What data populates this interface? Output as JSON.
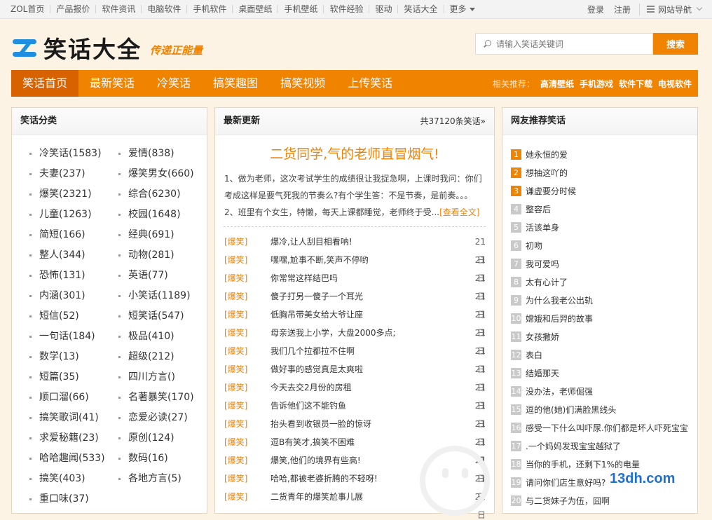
{
  "topbar": {
    "links": [
      "ZOL首页",
      "产品报价",
      "软件资讯",
      "电脑软件",
      "手机软件",
      "桌面壁纸",
      "手机壁纸",
      "软件经验",
      "驱动",
      "笑话大全"
    ],
    "more": "更多",
    "login": "登录",
    "register": "注册",
    "site_nav": "网站导航"
  },
  "header": {
    "logo_text": "笑话大全",
    "slogan": "传递正能量",
    "search_placeholder": "请输入笑话关键词",
    "search_button": "搜索"
  },
  "mainnav": {
    "tabs": [
      "笑话首页",
      "最新笑话",
      "冷笑话",
      "搞笑趣图",
      "搞笑视频",
      "上传笑话"
    ],
    "active_index": 0,
    "rec_label": "相关推荐：",
    "rec_links": [
      "高清壁纸",
      "手机游戏",
      "软件下载",
      "电视软件"
    ]
  },
  "left": {
    "title": "笑话分类",
    "categories": [
      "冷笑话(1583)",
      "爱情(838)",
      "夫妻(237)",
      "爆笑男女(660)",
      "爆笑(2321)",
      "综合(6230)",
      "儿童(1263)",
      "校园(1648)",
      "简短(166)",
      "经典(691)",
      "整人(344)",
      "动物(281)",
      "恐怖(131)",
      "英语(77)",
      "内涵(301)",
      "小笑话(1189)",
      "短信(52)",
      "短笑话(547)",
      "一句话(184)",
      "极品(410)",
      "数学(13)",
      "超级(212)",
      "短篇(35)",
      "四川方言()",
      "顺口溜(66)",
      "名著暴笑(170)",
      "搞笑歌词(41)",
      "恋爱必读(27)",
      "求爱秘籍(23)",
      "原创(124)",
      "哈哈趣闻(533)",
      "数码(16)",
      "搞笑(403)",
      "各地方言(5)",
      "重口味(37)"
    ]
  },
  "middle": {
    "title": "最新更新",
    "count": "共37120条笑话»",
    "headline": "二货同学,气的老师直冒烟气!",
    "summary": "1、做为老师，这次考试学生的成绩很让我捉急啊，上课时我问：你们考成这样是要气死我的节奏么?有个学生答：不是节奏，是前奏。。。2、班里有个女生，特懒，每天上课都睡觉，老师终于受...",
    "read_more": "[查看全文]",
    "news": [
      {
        "tag": "[爆笑]",
        "title": "爆冷,让人刮目相看呐!",
        "date": "21日"
      },
      {
        "tag": "[爆笑]",
        "title": "嘿嘿,尬事不断,笑声不停哟",
        "date": "21日"
      },
      {
        "tag": "[爆笑]",
        "title": "你常常这样结巴吗",
        "date": "21日"
      },
      {
        "tag": "[爆笑]",
        "title": "傻子打另一傻子一个耳光",
        "date": "21日"
      },
      {
        "tag": "[爆笑]",
        "title": "低胸吊带美女给大爷让座",
        "date": "21日"
      },
      {
        "tag": "[爆笑]",
        "title": "母亲送我上小学，大盘2000多点;",
        "date": "21日"
      },
      {
        "tag": "[爆笑]",
        "title": "我们几个拉都拉不住啊",
        "date": "21日"
      },
      {
        "tag": "[爆笑]",
        "title": "做好事的感觉真是太爽啦",
        "date": "21日"
      },
      {
        "tag": "[爆笑]",
        "title": "今天去交2月份的房租",
        "date": "21日"
      },
      {
        "tag": "[爆笑]",
        "title": "告诉他们这不能钓鱼",
        "date": "21日"
      },
      {
        "tag": "[爆笑]",
        "title": "抬头看到收银员一脸的惊讶",
        "date": "21日"
      },
      {
        "tag": "[爆笑]",
        "title": "逗B有笑才,搞笑不困难",
        "date": "21日"
      },
      {
        "tag": "[爆笑]",
        "title": "爆笑,他们的境界有些高!",
        "date": "21日"
      },
      {
        "tag": "[爆笑]",
        "title": "哈哈,都被老婆折腾的不轻呀!",
        "date": "21日"
      },
      {
        "tag": "[爆笑]",
        "title": "二货青年的爆笑尬事儿展",
        "date": "21日"
      }
    ]
  },
  "right": {
    "title": "网友推荐笑话",
    "items": [
      {
        "num": "1",
        "text": "她永恒的爱"
      },
      {
        "num": "2",
        "text": "想抽这吖的"
      },
      {
        "num": "3",
        "text": "谦虚要分时候"
      },
      {
        "num": "4",
        "text": "整容后"
      },
      {
        "num": "5",
        "text": "活该单身"
      },
      {
        "num": "6",
        "text": "初吻"
      },
      {
        "num": "7",
        "text": "我可爱吗"
      },
      {
        "num": "8",
        "text": "太有心计了"
      },
      {
        "num": "9",
        "text": "为什么我老公出轨"
      },
      {
        "num": "10",
        "text": "嫦娥和后羿的故事"
      },
      {
        "num": "11",
        "text": "女孩撒娇"
      },
      {
        "num": "12",
        "text": "表白"
      },
      {
        "num": "13",
        "text": "结婚那天"
      },
      {
        "num": "14",
        "text": "没办法，老师倔强"
      },
      {
        "num": "15",
        "text": "逗的他(她)们满脸黑线头"
      },
      {
        "num": "16",
        "text": "感受一下什么叫吓尿.你们都是坏人吓死宝宝"
      },
      {
        "num": "17",
        "text": ".一个妈妈发现宝宝越狱了"
      },
      {
        "num": "18",
        "text": "当你的手机，还剩下1%的电量"
      },
      {
        "num": "19",
        "text": "请问你们店生意好吗?"
      },
      {
        "num": "20",
        "text": "与二货妹子为伍，囧啊"
      }
    ],
    "watermark": "13dh.com"
  }
}
